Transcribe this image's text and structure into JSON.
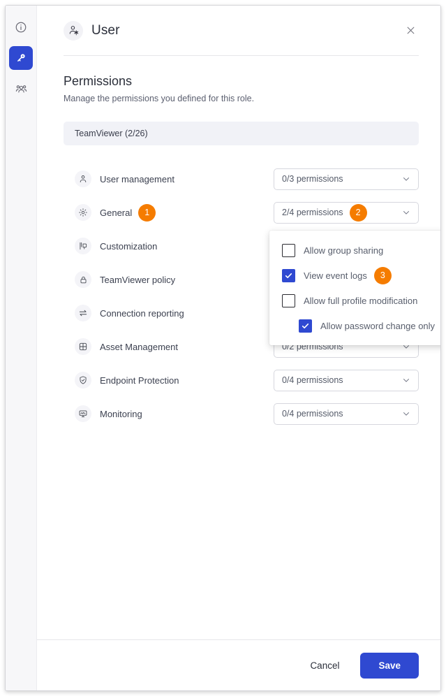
{
  "rail": {
    "items": [
      {
        "icon": "info-icon",
        "active": false
      },
      {
        "icon": "key-icon",
        "active": true
      },
      {
        "icon": "group-users-icon",
        "active": false
      }
    ]
  },
  "header": {
    "icon": "user-settings-icon",
    "title": "User",
    "close_label": "×"
  },
  "section": {
    "title": "Permissions",
    "subtitle": "Manage the permissions you defined for this role."
  },
  "group_band": {
    "label": "TeamViewer (2/26)"
  },
  "rows": [
    {
      "icon": "user-icon",
      "label": "User management",
      "badge": null,
      "select": "0/3 permissions",
      "select_badge": null
    },
    {
      "icon": "gear-icon",
      "label": "General",
      "badge": "1",
      "select": "2/4 permissions",
      "select_badge": "2"
    },
    {
      "icon": "customization-icon",
      "label": "Customization",
      "badge": null,
      "select": null,
      "select_badge": null
    },
    {
      "icon": "lock-icon",
      "label": "TeamViewer policy",
      "badge": null,
      "select": null,
      "select_badge": null
    },
    {
      "icon": "exchange-arrows-icon",
      "label": "Connection reporting",
      "badge": null,
      "select": null,
      "select_badge": null
    },
    {
      "icon": "grid-globe-icon",
      "label": "Asset Management",
      "badge": null,
      "select": "0/2 permissions",
      "select_badge": null
    },
    {
      "icon": "shield-check-icon",
      "label": "Endpoint Protection",
      "badge": null,
      "select": "0/4 permissions",
      "select_badge": null
    },
    {
      "icon": "monitor-icon",
      "label": "Monitoring",
      "badge": null,
      "select": "0/4 permissions",
      "select_badge": null
    }
  ],
  "dropdown": {
    "open": true,
    "items": [
      {
        "label": "Allow group sharing",
        "checked": false,
        "indent": false,
        "badge": null
      },
      {
        "label": "View event logs",
        "checked": true,
        "indent": false,
        "badge": "3"
      },
      {
        "label": "Allow full profile modification",
        "checked": false,
        "indent": false,
        "badge": null
      },
      {
        "label": "Allow password change only",
        "checked": true,
        "indent": true,
        "badge": null
      }
    ]
  },
  "footer": {
    "cancel_label": "Cancel",
    "save_label": "Save"
  },
  "colors": {
    "accent_blue": "#2f49d1",
    "badge_orange": "#f57c00",
    "band_bg": "#f1f2f7",
    "rail_bg": "#f7f7f9"
  }
}
